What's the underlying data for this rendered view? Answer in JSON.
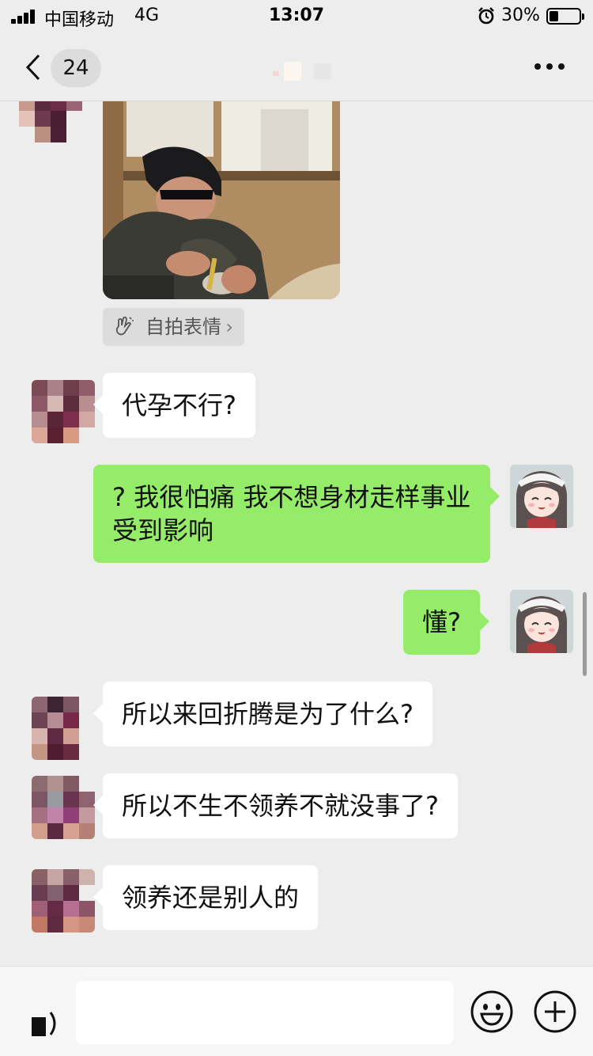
{
  "status_bar": {
    "carrier": "中国移动",
    "network": "4G",
    "time": "13:07",
    "battery_percent": "30%",
    "battery_level": 0.3,
    "icons": [
      "signal-icon",
      "alarm-icon",
      "battery-icon"
    ]
  },
  "nav": {
    "unread_count": "24",
    "title": "",
    "icons": [
      "back-chevron-icon",
      "more-dots-icon"
    ]
  },
  "messages": [
    {
      "side": "in",
      "type": "image"
    },
    {
      "side": "in",
      "text": "代孕不行?"
    },
    {
      "side": "out",
      "text": "? 我很怕痛 我不想身材走样事业受到影响"
    },
    {
      "side": "out",
      "text": "懂?"
    },
    {
      "side": "in",
      "text": "所以来回折腾是为了什么?"
    },
    {
      "side": "in",
      "text": "所以不生不领养不就没事了?"
    },
    {
      "side": "in",
      "text": "领养还是别人的"
    }
  ],
  "selfie_chip": {
    "label": "自拍表情",
    "chevron": "›",
    "icon": "selfie-sticker-icon"
  },
  "input_bar": {
    "placeholder": "",
    "icons": [
      "voice-icon",
      "emoji-icon",
      "plus-icon"
    ]
  },
  "colors": {
    "background": "#ededed",
    "outgoing_bubble": "#95ec69",
    "incoming_bubble": "#ffffff",
    "input_bar": "#f6f6f6"
  }
}
